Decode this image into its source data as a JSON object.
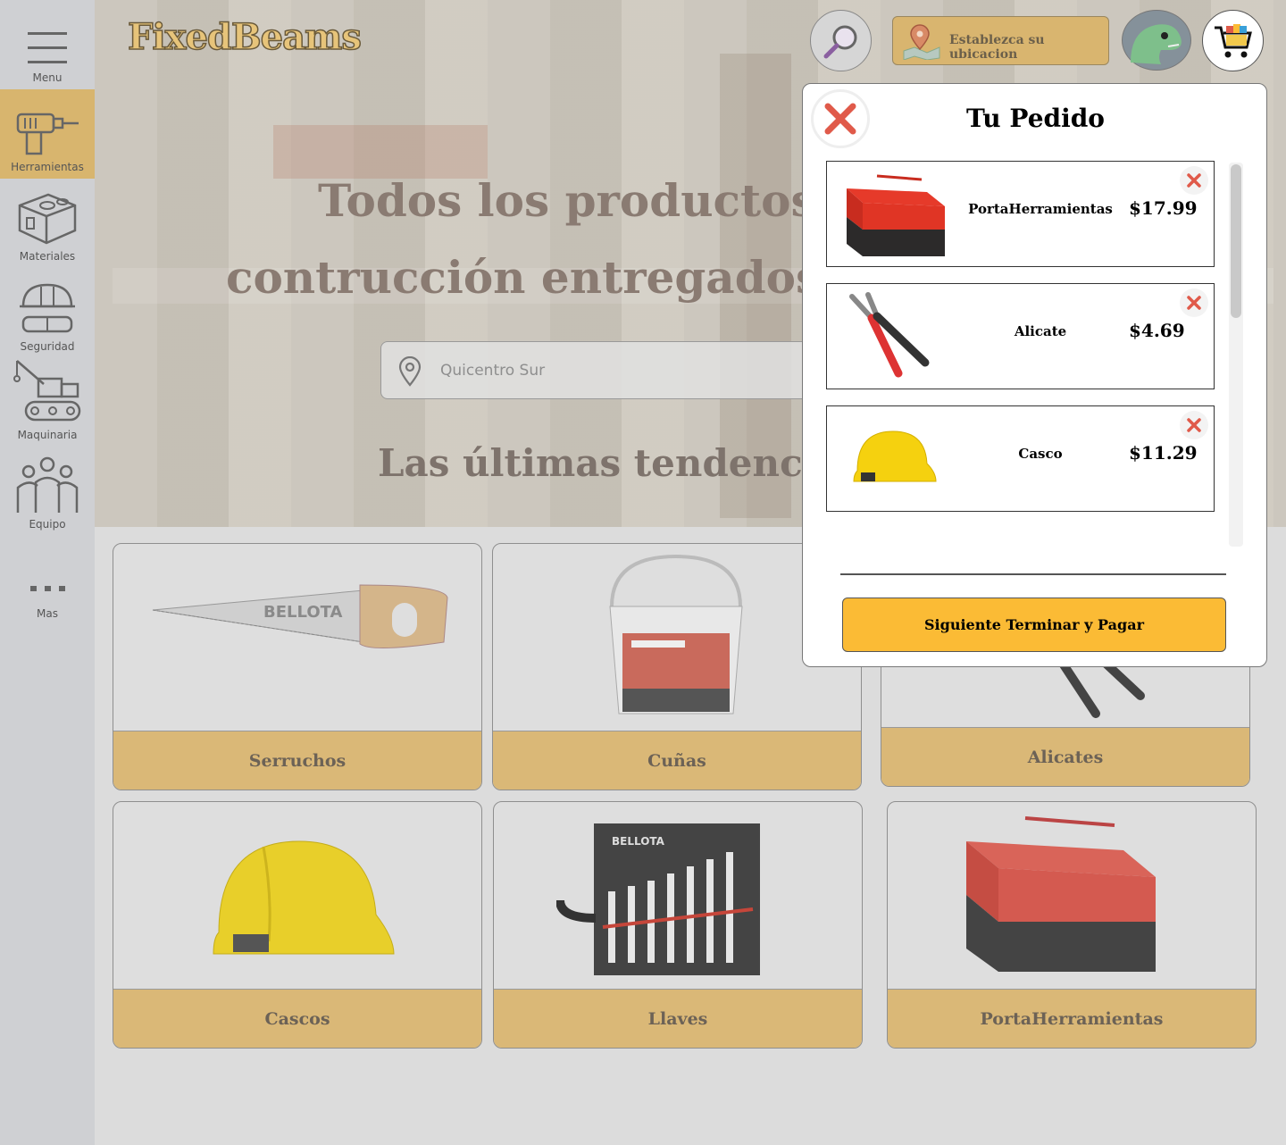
{
  "brand": {
    "logo": "FixedBeams"
  },
  "sidebar": {
    "items": [
      {
        "label": "Menu",
        "icon": "hamburger-icon"
      },
      {
        "label": "Herramientas",
        "icon": "drill-icon",
        "active": true
      },
      {
        "label": "Materiales",
        "icon": "brick-icon"
      },
      {
        "label": "Seguridad",
        "icon": "safety-gear-icon"
      },
      {
        "label": "Maquinaria",
        "icon": "crane-icon"
      },
      {
        "label": "Equipo",
        "icon": "team-icon"
      },
      {
        "label": "Mas",
        "icon": "more-icon"
      }
    ]
  },
  "header": {
    "location_label": "Establezca su ubicacion",
    "search_icon": "magnifier-icon",
    "avatar_icon": "dinosaur-avatar-icon",
    "cart_icon": "cart-icon"
  },
  "hero": {
    "title_line1": "Todos los productos fav",
    "title_line2": "contrucción entregados al p",
    "search_placeholder": "Quicentro Sur",
    "trend_heading": "Las últimas tendencias e"
  },
  "categories": [
    {
      "label": "Serruchos",
      "icon": "saw-icon"
    },
    {
      "label": "Cuñas",
      "icon": "bucket-icon"
    },
    {
      "label": "Alicates",
      "icon": "pliers-icon"
    },
    {
      "label": "Cascos",
      "icon": "helmet-icon"
    },
    {
      "label": "Llaves",
      "icon": "wrench-set-icon"
    },
    {
      "label": "PortaHerramientas",
      "icon": "toolbox-icon"
    }
  ],
  "order_panel": {
    "title": "Tu Pedido",
    "items": [
      {
        "name": "PortaHerramientas",
        "price": "$17.99",
        "icon": "toolbox-icon"
      },
      {
        "name": "Alicate",
        "price": "$4.69",
        "icon": "pliers-icon"
      },
      {
        "name": "Casco",
        "price": "$11.29",
        "icon": "helmet-icon"
      }
    ],
    "checkout_label": "Siguiente Terminar y Pagar"
  },
  "colors": {
    "accent": "#fbbb35",
    "category_footer": "#dab877",
    "remove_x": "#e05a4a"
  }
}
